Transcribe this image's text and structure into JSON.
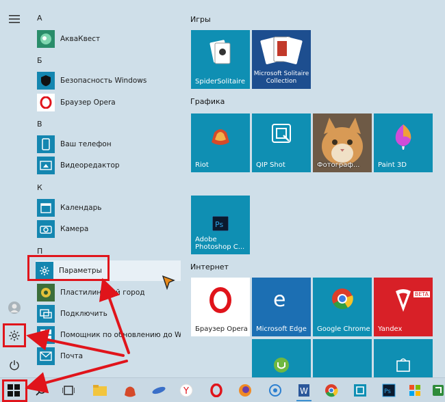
{
  "apps": {
    "letters": [
      "А",
      "Б",
      "В",
      "К",
      "П"
    ],
    "items": [
      {
        "label": "АкваКвест"
      },
      {
        "label": "Безопасность Windows"
      },
      {
        "label": "Браузер Opera"
      },
      {
        "label": "Ваш телефон"
      },
      {
        "label": "Видеоредактор"
      },
      {
        "label": "Календарь"
      },
      {
        "label": "Камера"
      },
      {
        "label": "Параметры"
      },
      {
        "label": "Пластилиновый город"
      },
      {
        "label": "Подключить"
      },
      {
        "label": "Помощник по обновлению до Win..."
      },
      {
        "label": "Почта"
      }
    ]
  },
  "tiles": {
    "groups": [
      "Игры",
      "Графика",
      "Интернет"
    ],
    "items": [
      {
        "label": "SpiderSolitaire",
        "icon": "spider-solitaire-icon"
      },
      {
        "label": "Microsoft Solitaire Collection",
        "icon": "solitaire-cards-icon"
      },
      {
        "label": "Riot",
        "icon": "riot-icon"
      },
      {
        "label": "QIP Shot",
        "icon": "qip-shot-icon"
      },
      {
        "label": "Фотограф...",
        "icon": "cat-photo"
      },
      {
        "label": "Paint 3D",
        "icon": "paint3d-icon"
      },
      {
        "label": "Adobe Photoshop C...",
        "icon": "photoshop-icon"
      },
      {
        "label": "Браузер Opera",
        "icon": "opera-icon"
      },
      {
        "label": "Microsoft Edge",
        "icon": "edge-icon"
      },
      {
        "label": "Google Chrome",
        "icon": "chrome-icon"
      },
      {
        "label": "Yandex",
        "icon": "yandex-icon"
      },
      {
        "label": "BETA",
        "icon": "beta-badge"
      }
    ]
  },
  "colors": {
    "highlight": "#e0141b",
    "tile": "#0f8fb3",
    "accent": "#1486b0"
  }
}
